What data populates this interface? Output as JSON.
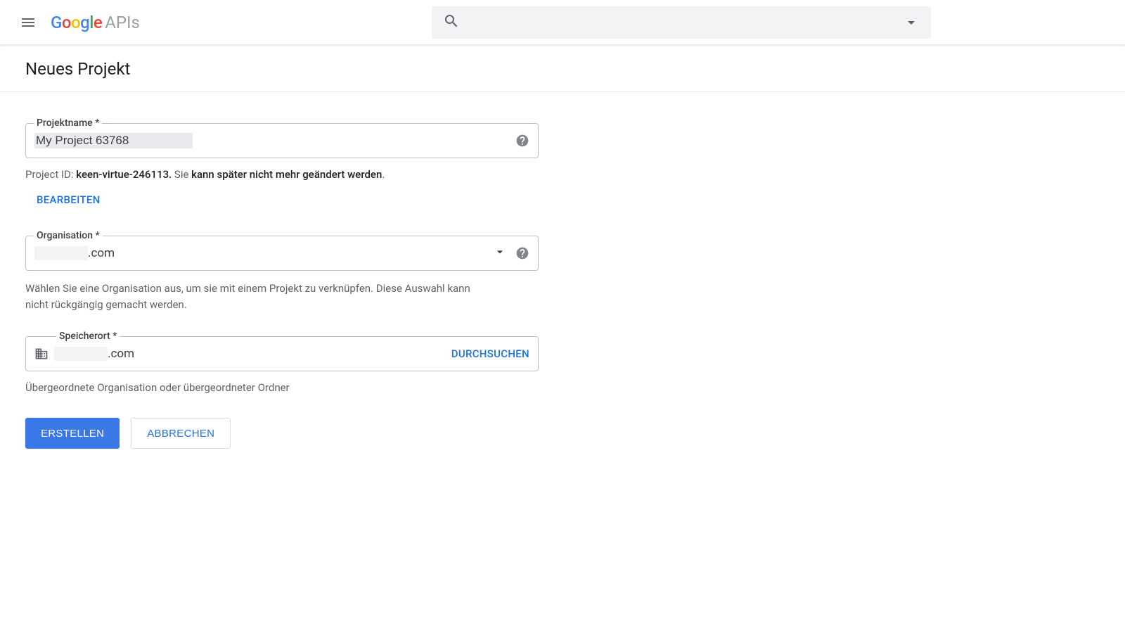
{
  "header": {
    "logo_brand": "Google",
    "logo_suffix": "APIs",
    "search_placeholder": ""
  },
  "page": {
    "title": "Neues Projekt"
  },
  "project_name": {
    "label": "Projektname *",
    "value": "My Project 63768",
    "helper_lead": "Project ID: ",
    "helper_id": "keen-virtue-246113.",
    "helper_trail1": " Sie ",
    "helper_trail2": "kann später nicht mehr geändert werden",
    "helper_dot": ".",
    "edit_label": "BEARBEITEN"
  },
  "organisation": {
    "label": "Organisation *",
    "value_suffix": ".com",
    "helper": "Wählen Sie eine Organisation aus, um sie mit einem Projekt zu verknüpfen. Diese Auswahl kann nicht rückgängig gemacht werden."
  },
  "location": {
    "label": "Speicherort *",
    "value_suffix": ".com",
    "browse_label": "DURCHSUCHEN",
    "helper": "Übergeordnete Organisation oder übergeordneter Ordner"
  },
  "buttons": {
    "create": "ERSTELLEN",
    "cancel": "ABBRECHEN"
  }
}
